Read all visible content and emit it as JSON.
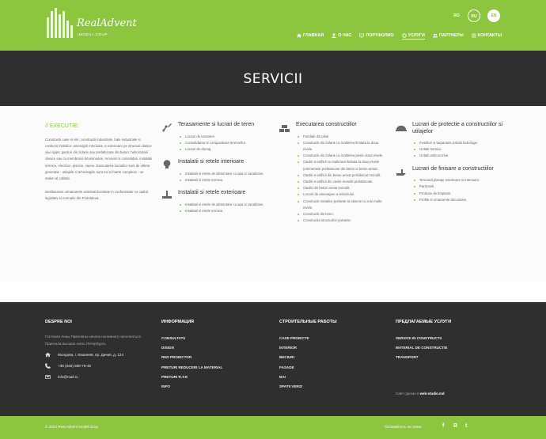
{
  "header": {
    "logo_name": "RealAdvent",
    "logo_tagline": "IMOBILI GRUP",
    "languages": [
      "RO",
      "RU",
      "EN"
    ],
    "nav": [
      {
        "label": "ГЛАВНАЯ",
        "icon": "home-icon"
      },
      {
        "label": "О НАС",
        "icon": "user-icon"
      },
      {
        "label": "ПОРТФОЛИО",
        "icon": "monitor-icon"
      },
      {
        "label": "УСЛУГИ",
        "icon": "gear-icon"
      },
      {
        "label": "ПАРТНЕРЫ",
        "icon": "users-icon"
      },
      {
        "label": "КОНТАКТЫ",
        "icon": "contact-icon"
      }
    ]
  },
  "hero": {
    "title": "SERVICII"
  },
  "execution": {
    "title": "// EXECUTIE:",
    "paragraph1": "Constructii case si vile; constructii industriale, hale industriale si confectii metalice; amenajari interioare si exterioare pe structuri clasice sau rigips; garduri din zidarie sau prefabricate din beton; hidroizolatii clasice sau cu membrane bituminoase, renovari si consolidari, instalatii termice, electrice, piscine, saune. Executarea lucrarilor sunt de ultima generatie - utilajele si tehnologiile sunt noi si foarte complexe - un etalon al calitatii.",
    "paragraph2": "Desfasuram urmatoarele activitati licentiate in conformitate cu cadrul legislativ si normativ din R.Moldova:"
  },
  "column2": [
    {
      "title": "Terasamente si lucrari de teren",
      "icon": "shovel-icon",
      "items": [
        "Lucrari de terasiere.",
        "Consolidarea si compactarea terenurilor.",
        "Lucrari de drenaj."
      ]
    },
    {
      "title": "Instalatii si retele interioare",
      "icon": "lightbulb-icon",
      "items": [
        "Instalatii si retele de alimentare cu apa si canalizare.",
        "Instalatii si retele termice."
      ]
    },
    {
      "title": "Instalatii si retele exterioare",
      "icon": "pipe-icon",
      "items": [
        "Instalatii si retele de alimentare cu apa si canalizare.",
        "Instalatii si retele termice."
      ]
    }
  ],
  "column3": {
    "title": "Executarea constructiilor",
    "icon": "bricks-icon",
    "items": [
      "Fundatii din piloti",
      "Constructii din zidarie cu inaltimea limitata la doua nivele.",
      "Constructii din zidarie cu inaltimea peste doua nivele.",
      "Cladiri si edificii cu inaltimea limitata la doua nivele (elementele prefabricate din beton si beton armat.",
      "Cladiri si edificii din beton armat prefabricat monolit.",
      "Cladiri si edificii din cadre monolit prefabricate.",
      "Cladiri din beton armat monolit.",
      "Lucrari de amenajare a teritoriului.",
      "Constructii metalice portante la obiecte cu mai multe nivele.",
      "Constructii din lemn.",
      "Constructia structurilor portante."
    ]
  },
  "column4": [
    {
      "title": "Lucrari de protectie a constructiilor si utilajelor",
      "icon": "helmet-icon",
      "items": [
        "Invelitori si tarpantele,izolatii hidrofuge.",
        "Izolatii termice.",
        "Izolatii anticorozive."
      ]
    },
    {
      "title": "Lucrari de finisare a constructiilor",
      "icon": "trowel-icon",
      "items": [
        "Tencuieli,placaje exterioare si interioare.",
        "Pardoseli.",
        "Produse de timplarie.",
        "Profile si ornamente decorative."
      ]
    }
  ],
  "footer": {
    "about": {
      "heading": "DESPRE NOI",
      "text": "Гостиная Анны Павловны начала понемногу наполняться. Приехала высшая знать Петербурга,",
      "address": "Молдова, г. Кишинев, пр. Дачия, д. 124",
      "phone": "+38 (048) 568-79-46",
      "email": "info@mail.ru"
    },
    "info": {
      "heading": "ИНФОРМАЦИЯ",
      "links": [
        "CONSULTATII",
        "DISIGN",
        "RED PROIECTOR",
        "PRETURI REDUCERI LA MATERIAL",
        "PRETURI R.T.R",
        "INFO"
      ]
    },
    "works": {
      "heading": "СТРОИТЕЛЬНЫЕ РАБОТЫ",
      "links": [
        "CASE PROIECTE",
        "INTERIOR",
        "BECIURI",
        "FASADE",
        "BAI",
        "SPATII VERZI"
      ]
    },
    "services": {
      "heading": "ПРЕДЛАГАЕМЫЕ УСЛУГИ",
      "links": [
        "SERVICII IN CONSTRUCTII",
        "MATERIAL DE CONSTRUCTIE",
        "TRANSPORT"
      ],
      "credit_prefix": "Сайт сделан в",
      "credit_link": "web-studio.md"
    }
  },
  "bottom": {
    "copyright": "© 2013 Real Advent Imobili Grup",
    "follow": "Оставайтесь на связи",
    "social": [
      "f",
      "B",
      "t"
    ]
  },
  "colors": {
    "accent": "#8cc63f",
    "dark": "#2f2f2f"
  }
}
